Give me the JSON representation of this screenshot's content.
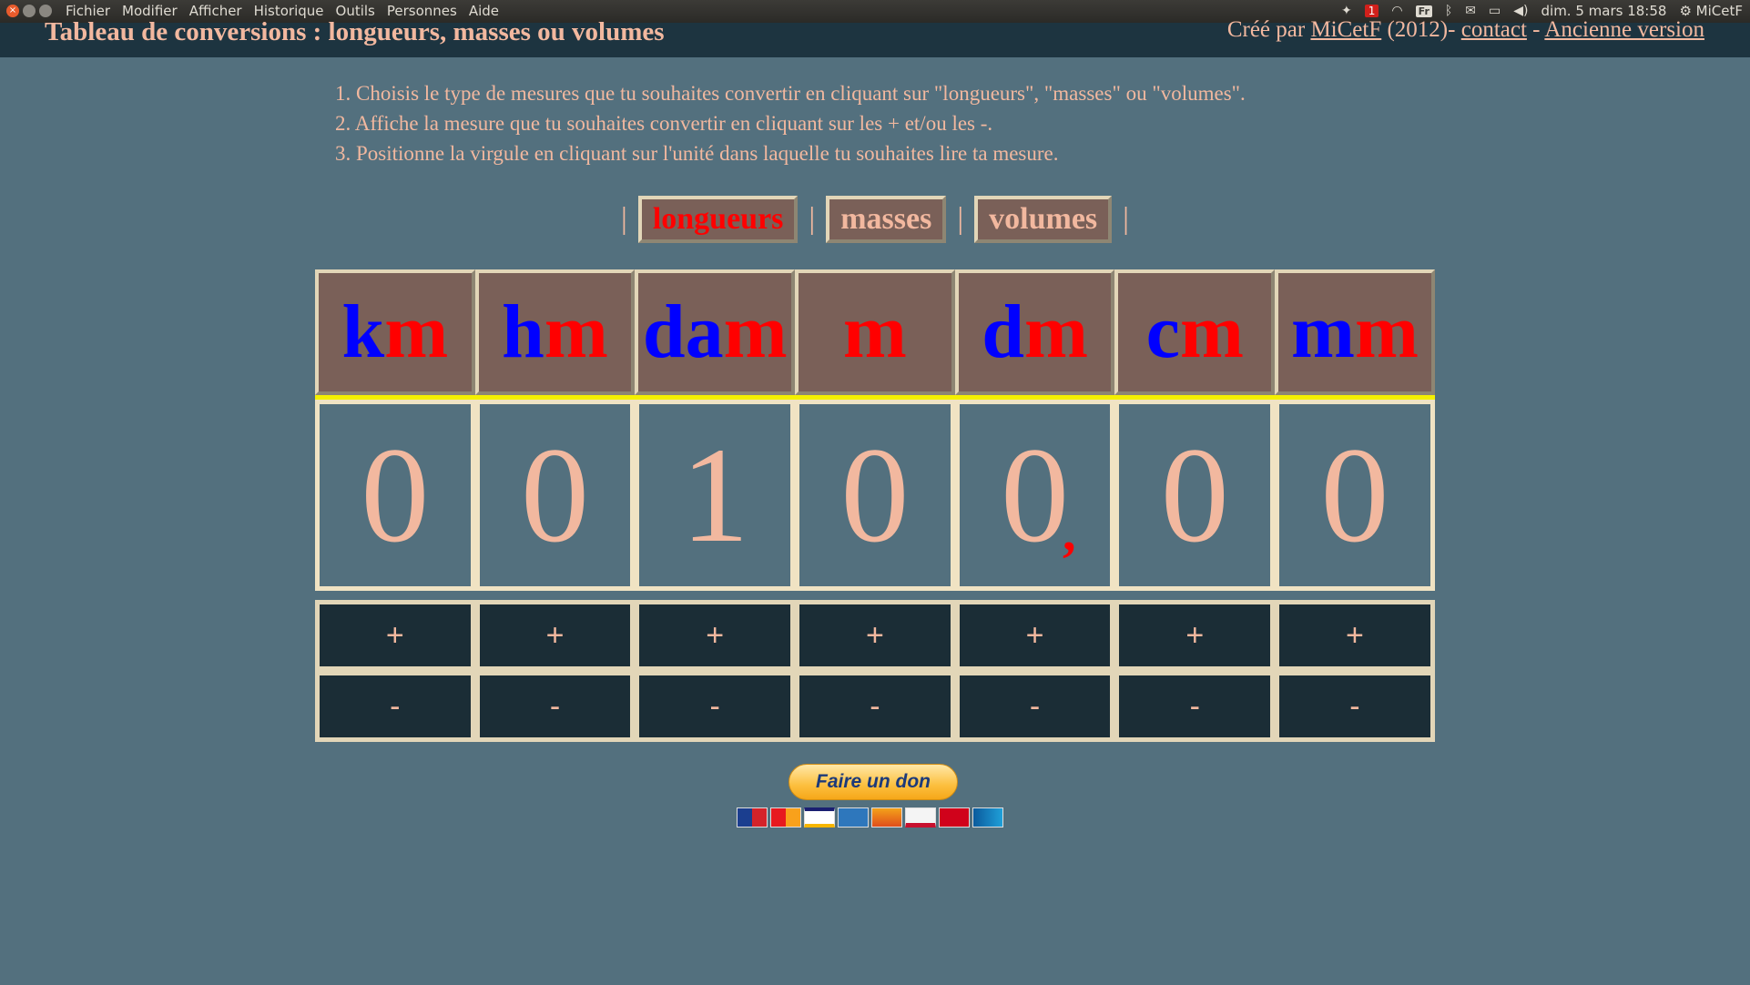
{
  "os": {
    "menu": [
      "Fichier",
      "Modifier",
      "Afficher",
      "Historique",
      "Outils",
      "Personnes",
      "Aide"
    ],
    "notification_count": "1",
    "keyboard": "Fr",
    "datetime": "dim. 5 mars 18:58",
    "user": "MiCetF"
  },
  "header": {
    "title": "Tableau de conversions : longueurs, masses ou volumes",
    "credit_prefix": "Créé par ",
    "author": "MiCetF",
    "year": " (2012)- ",
    "contact": "contact",
    "dash": " - ",
    "old_version": "Ancienne version"
  },
  "instructions": [
    "1. Choisis le type de mesures que tu souhaites convertir en cliquant sur \"longueurs\", \"masses\" ou \"volumes\".",
    "2. Affiche la mesure que tu souhaites convertir en cliquant sur les + et/ou les -.",
    "3. Positionne la virgule en cliquant sur l'unité dans laquelle tu souhaites lire ta mesure."
  ],
  "tabs": {
    "separator": "|",
    "items": [
      {
        "label": "longueurs",
        "active": true
      },
      {
        "label": "masses",
        "active": false
      },
      {
        "label": "volumes",
        "active": false
      }
    ]
  },
  "units": [
    {
      "prefix": "k",
      "base": "m"
    },
    {
      "prefix": "h",
      "base": "m"
    },
    {
      "prefix": "da",
      "base": "m"
    },
    {
      "prefix": "",
      "base": "m"
    },
    {
      "prefix": "d",
      "base": "m"
    },
    {
      "prefix": "c",
      "base": "m"
    },
    {
      "prefix": "m",
      "base": "m"
    }
  ],
  "digits": [
    "0",
    "0",
    "1",
    "0",
    "0",
    "0",
    "0"
  ],
  "comma": ",",
  "plus_label": "+",
  "minus_label": "-",
  "donate": {
    "label": "Faire un don"
  },
  "colors": {
    "prefix": "#0000ff",
    "base": "#ff0000",
    "text": "#f2b89f",
    "background": "#53707e",
    "header": "#1d3440"
  }
}
